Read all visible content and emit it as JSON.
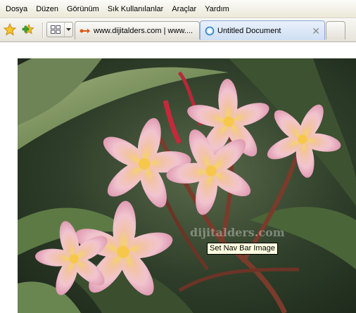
{
  "menubar": {
    "items": [
      "Dosya",
      "Düzen",
      "Görünüm",
      "Sık Kullanılanlar",
      "Araçlar",
      "Yardım"
    ]
  },
  "toolbar": {
    "favorites_icon": "star-icon",
    "add_favorite_icon": "add-star-icon",
    "quick_tabs_icon": "grid-icon",
    "quick_tabs_dropdown_icon": "chevron-down-icon"
  },
  "tabs": [
    {
      "title": "www.dijitalders.com | www....",
      "icon": "page-arrow-icon",
      "active": false
    },
    {
      "title": "Untitled Document",
      "icon": "ie-page-icon",
      "active": true,
      "close": "✕"
    }
  ],
  "content": {
    "watermark": "dijitalders.com",
    "tooltip": "Set Nav Bar Image"
  },
  "colors": {
    "tab_active": "#cfdff3",
    "menubar": "#ece9d8",
    "tooltip_bg": "#ffffe1"
  }
}
